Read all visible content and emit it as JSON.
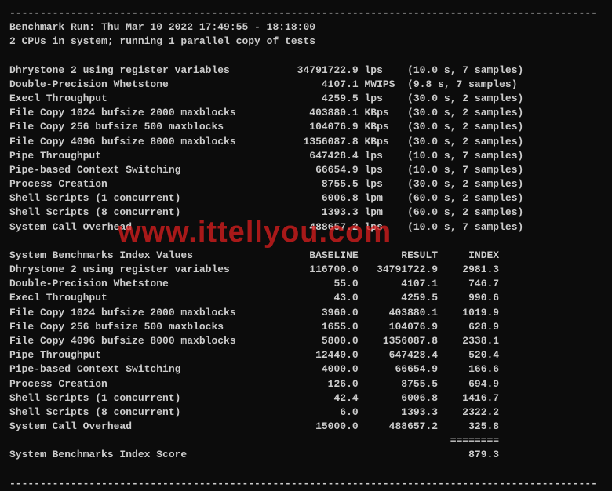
{
  "divider_char": "-",
  "header": {
    "run_line": "Benchmark Run: Thu Mar 10 2022 17:49:55 - 18:18:00",
    "cpu_line": "2 CPUs in system; running 1 parallel copy of tests"
  },
  "results": [
    {
      "name": "Dhrystone 2 using register variables",
      "value": "34791722.9",
      "unit": "lps",
      "timing": "(10.0 s, 7 samples)"
    },
    {
      "name": "Double-Precision Whetstone",
      "value": "4107.1",
      "unit": "MWIPS",
      "timing": "(9.8 s, 7 samples)"
    },
    {
      "name": "Execl Throughput",
      "value": "4259.5",
      "unit": "lps",
      "timing": "(30.0 s, 2 samples)"
    },
    {
      "name": "File Copy 1024 bufsize 2000 maxblocks",
      "value": "403880.1",
      "unit": "KBps",
      "timing": "(30.0 s, 2 samples)"
    },
    {
      "name": "File Copy 256 bufsize 500 maxblocks",
      "value": "104076.9",
      "unit": "KBps",
      "timing": "(30.0 s, 2 samples)"
    },
    {
      "name": "File Copy 4096 bufsize 8000 maxblocks",
      "value": "1356087.8",
      "unit": "KBps",
      "timing": "(30.0 s, 2 samples)"
    },
    {
      "name": "Pipe Throughput",
      "value": "647428.4",
      "unit": "lps",
      "timing": "(10.0 s, 7 samples)"
    },
    {
      "name": "Pipe-based Context Switching",
      "value": "66654.9",
      "unit": "lps",
      "timing": "(10.0 s, 7 samples)"
    },
    {
      "name": "Process Creation",
      "value": "8755.5",
      "unit": "lps",
      "timing": "(30.0 s, 2 samples)"
    },
    {
      "name": "Shell Scripts (1 concurrent)",
      "value": "6006.8",
      "unit": "lpm",
      "timing": "(60.0 s, 2 samples)"
    },
    {
      "name": "Shell Scripts (8 concurrent)",
      "value": "1393.3",
      "unit": "lpm",
      "timing": "(60.0 s, 2 samples)"
    },
    {
      "name": "System Call Overhead",
      "value": "488657.2",
      "unit": "lps",
      "timing": "(10.0 s, 7 samples)"
    }
  ],
  "index_header": {
    "title": "System Benchmarks Index Values",
    "col_baseline": "BASELINE",
    "col_result": "RESULT",
    "col_index": "INDEX"
  },
  "index_rows": [
    {
      "name": "Dhrystone 2 using register variables",
      "baseline": "116700.0",
      "result": "34791722.9",
      "index": "2981.3"
    },
    {
      "name": "Double-Precision Whetstone",
      "baseline": "55.0",
      "result": "4107.1",
      "index": "746.7"
    },
    {
      "name": "Execl Throughput",
      "baseline": "43.0",
      "result": "4259.5",
      "index": "990.6"
    },
    {
      "name": "File Copy 1024 bufsize 2000 maxblocks",
      "baseline": "3960.0",
      "result": "403880.1",
      "index": "1019.9"
    },
    {
      "name": "File Copy 256 bufsize 500 maxblocks",
      "baseline": "1655.0",
      "result": "104076.9",
      "index": "628.9"
    },
    {
      "name": "File Copy 4096 bufsize 8000 maxblocks",
      "baseline": "5800.0",
      "result": "1356087.8",
      "index": "2338.1"
    },
    {
      "name": "Pipe Throughput",
      "baseline": "12440.0",
      "result": "647428.4",
      "index": "520.4"
    },
    {
      "name": "Pipe-based Context Switching",
      "baseline": "4000.0",
      "result": "66654.9",
      "index": "166.6"
    },
    {
      "name": "Process Creation",
      "baseline": "126.0",
      "result": "8755.5",
      "index": "694.9"
    },
    {
      "name": "Shell Scripts (1 concurrent)",
      "baseline": "42.4",
      "result": "6006.8",
      "index": "1416.7"
    },
    {
      "name": "Shell Scripts (8 concurrent)",
      "baseline": "6.0",
      "result": "1393.3",
      "index": "2322.2"
    },
    {
      "name": "System Call Overhead",
      "baseline": "15000.0",
      "result": "488657.2",
      "index": "325.8"
    }
  ],
  "score": {
    "label": "System Benchmarks Index Score",
    "value": "879.3",
    "equals": "========"
  },
  "watermark": "www.ittellyou.com"
}
